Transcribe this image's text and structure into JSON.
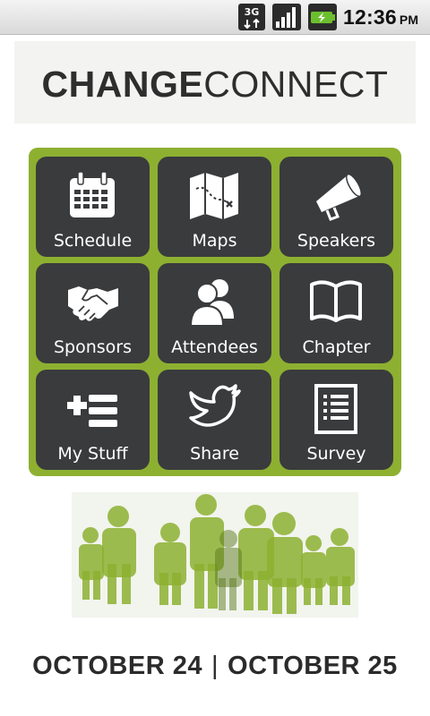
{
  "status_bar": {
    "network": "3G",
    "time": "12:36",
    "ampm": "PM",
    "icons": [
      "3g-data-icon",
      "signal-strength-icon",
      "battery-charging-icon"
    ]
  },
  "header": {
    "logo_bold": "CHANGE",
    "logo_light": "CONNECT"
  },
  "menu": {
    "accent_color": "#8db031",
    "tile_color": "#3a3b3d",
    "items": [
      {
        "label": "Schedule",
        "icon": "calendar-icon"
      },
      {
        "label": "Maps",
        "icon": "map-icon"
      },
      {
        "label": "Speakers",
        "icon": "megaphone-icon"
      },
      {
        "label": "Sponsors",
        "icon": "handshake-icon"
      },
      {
        "label": "Attendees",
        "icon": "people-icon"
      },
      {
        "label": "Chapter",
        "icon": "open-book-icon"
      },
      {
        "label": "My Stuff",
        "icon": "add-list-icon"
      },
      {
        "label": "Share",
        "icon": "twitter-bird-icon"
      },
      {
        "label": "Survey",
        "icon": "checklist-icon"
      }
    ]
  },
  "footer": {
    "date_start": "OCTOBER 24",
    "separator": "|",
    "date_end": "OCTOBER 25"
  }
}
